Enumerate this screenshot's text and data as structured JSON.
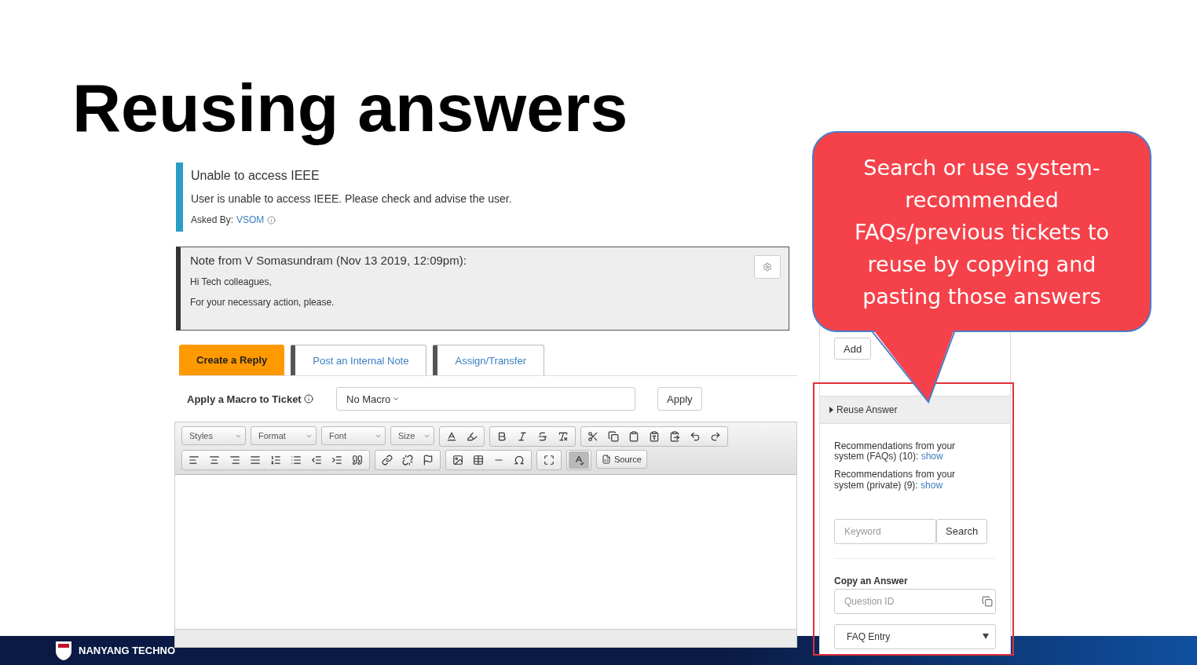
{
  "slide_title": "Reusing answers",
  "ticket": {
    "subject": "Unable to access IEEE",
    "body": "User is unable to access IEEE. Please check and advise the user.",
    "asked_by_label": "Asked By:",
    "asked_by": "VSOM"
  },
  "note": {
    "header": "Note from V Somasundram (Nov 13 2019, 12:09pm):",
    "lines": [
      "Hi Tech colleagues,",
      "For your necessary action, please."
    ]
  },
  "tabs": [
    {
      "label": "Create a Reply",
      "selected": true
    },
    {
      "label": "Post an Internal Note",
      "selected": false
    },
    {
      "label": "Assign/Transfer",
      "selected": false
    }
  ],
  "macro": {
    "label": "Apply a Macro to Ticket",
    "value": "No Macro",
    "button": "Apply"
  },
  "toolbar": {
    "dropdowns": [
      "Styles",
      "Format",
      "Font",
      "Size"
    ],
    "source": "Source",
    "spellcheck_on": true
  },
  "side": {
    "add_button": "Add",
    "section_title": "Reuse Answer",
    "recommendations": [
      {
        "text": "Recommendations from your system (FAQs) (10):",
        "link": "show"
      },
      {
        "text": "Recommendations from your system (private) (9):",
        "link": "show"
      }
    ],
    "keyword_placeholder": "Keyword",
    "search_button": "Search",
    "copy_label": "Copy an Answer",
    "question_placeholder": "Question ID",
    "faq_select": "FAQ Entry"
  },
  "callout": "Search or use system-recommended FAQs/previous tickets to reuse by copying  and pasting those answers",
  "footer": {
    "org": "NANYANG TECHNO"
  }
}
